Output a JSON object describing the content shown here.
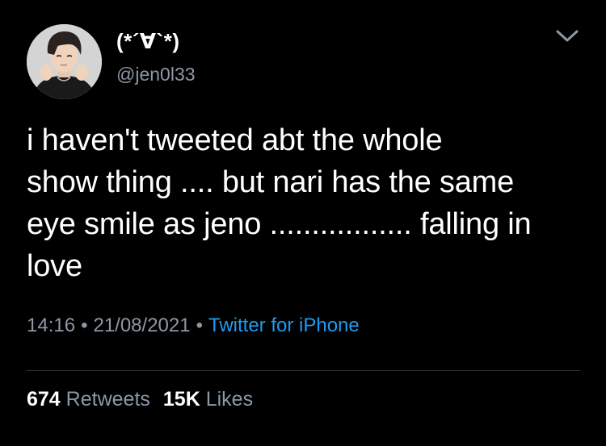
{
  "tweet": {
    "author": {
      "display_name": "(*´∀`*)",
      "handle": "@jen0l33",
      "avatar_icon": "profile-photo"
    },
    "more_icon": "chevron-down-icon",
    "text_lines": [
      "i haven't tweeted abt the whole",
      "show thing .... but nari has the same",
      "eye smile as jeno ................. falling in",
      "love"
    ],
    "time": "14:16",
    "date": "21/08/2021",
    "separator": "•",
    "source": "Twitter for iPhone",
    "stats": {
      "retweets_count": "674",
      "retweets_label": "Retweets",
      "likes_count": "15K",
      "likes_label": "Likes"
    },
    "colors": {
      "background": "#000000",
      "text": "#ffffff",
      "secondary": "#8b98a5",
      "link": "#1d9bf0",
      "divider": "#2f3336"
    }
  }
}
